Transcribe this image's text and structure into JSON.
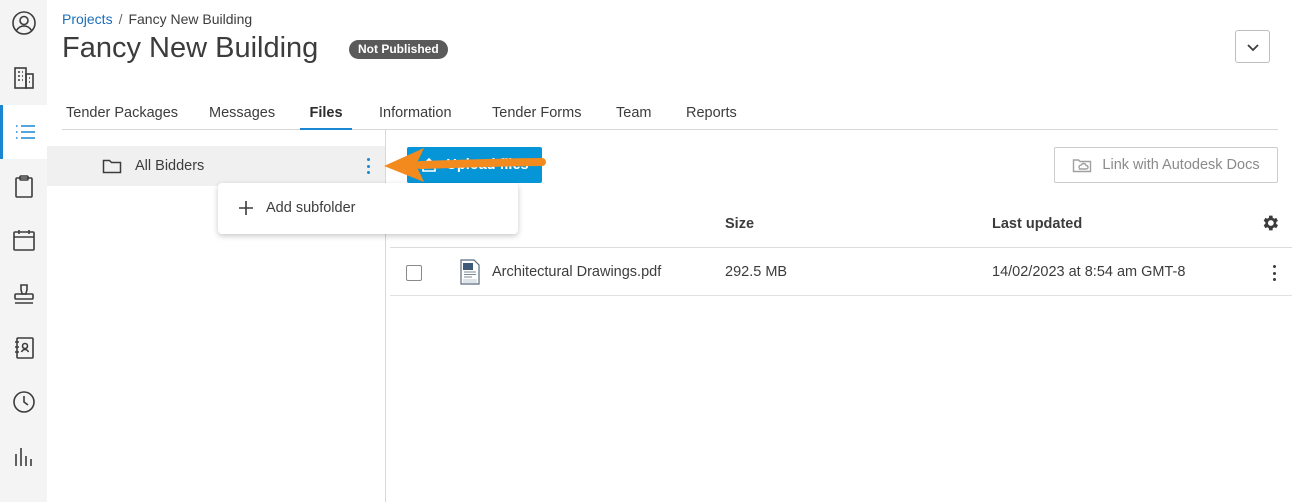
{
  "breadcrumb": {
    "root": "Projects",
    "separator": "/",
    "current": "Fancy New Building"
  },
  "header": {
    "title": "Fancy New Building",
    "status": "Not Published"
  },
  "tabs": [
    {
      "label": "Tender Packages"
    },
    {
      "label": "Messages"
    },
    {
      "label": "Files"
    },
    {
      "label": "Information"
    },
    {
      "label": "Tender Forms"
    },
    {
      "label": "Team"
    },
    {
      "label": "Reports"
    }
  ],
  "active_tab": "Files",
  "folders": {
    "root": "All Bidders"
  },
  "context_menu": {
    "add_subfolder": "Add subfolder"
  },
  "toolbar": {
    "upload": "Upload files",
    "link": "Link with Autodesk Docs"
  },
  "table": {
    "headers": {
      "size": "Size",
      "updated": "Last updated"
    },
    "rows": [
      {
        "name": "Architectural Drawings.pdf",
        "size": "292.5 MB",
        "updated": "14/02/2023 at 8:54 am GMT-8"
      }
    ]
  },
  "colors": {
    "accent": "#1b86d2",
    "upload_button": "#0696d7",
    "badge": "#5a5a5a",
    "annotation_arrow": "#f28a1e"
  },
  "icons": {
    "rail": [
      "user-circle-icon",
      "building-icon",
      "list-icon",
      "clipboard-icon",
      "calendar-icon",
      "stamp-icon",
      "contacts-book-icon",
      "clock-icon",
      "bar-chart-icon"
    ]
  }
}
